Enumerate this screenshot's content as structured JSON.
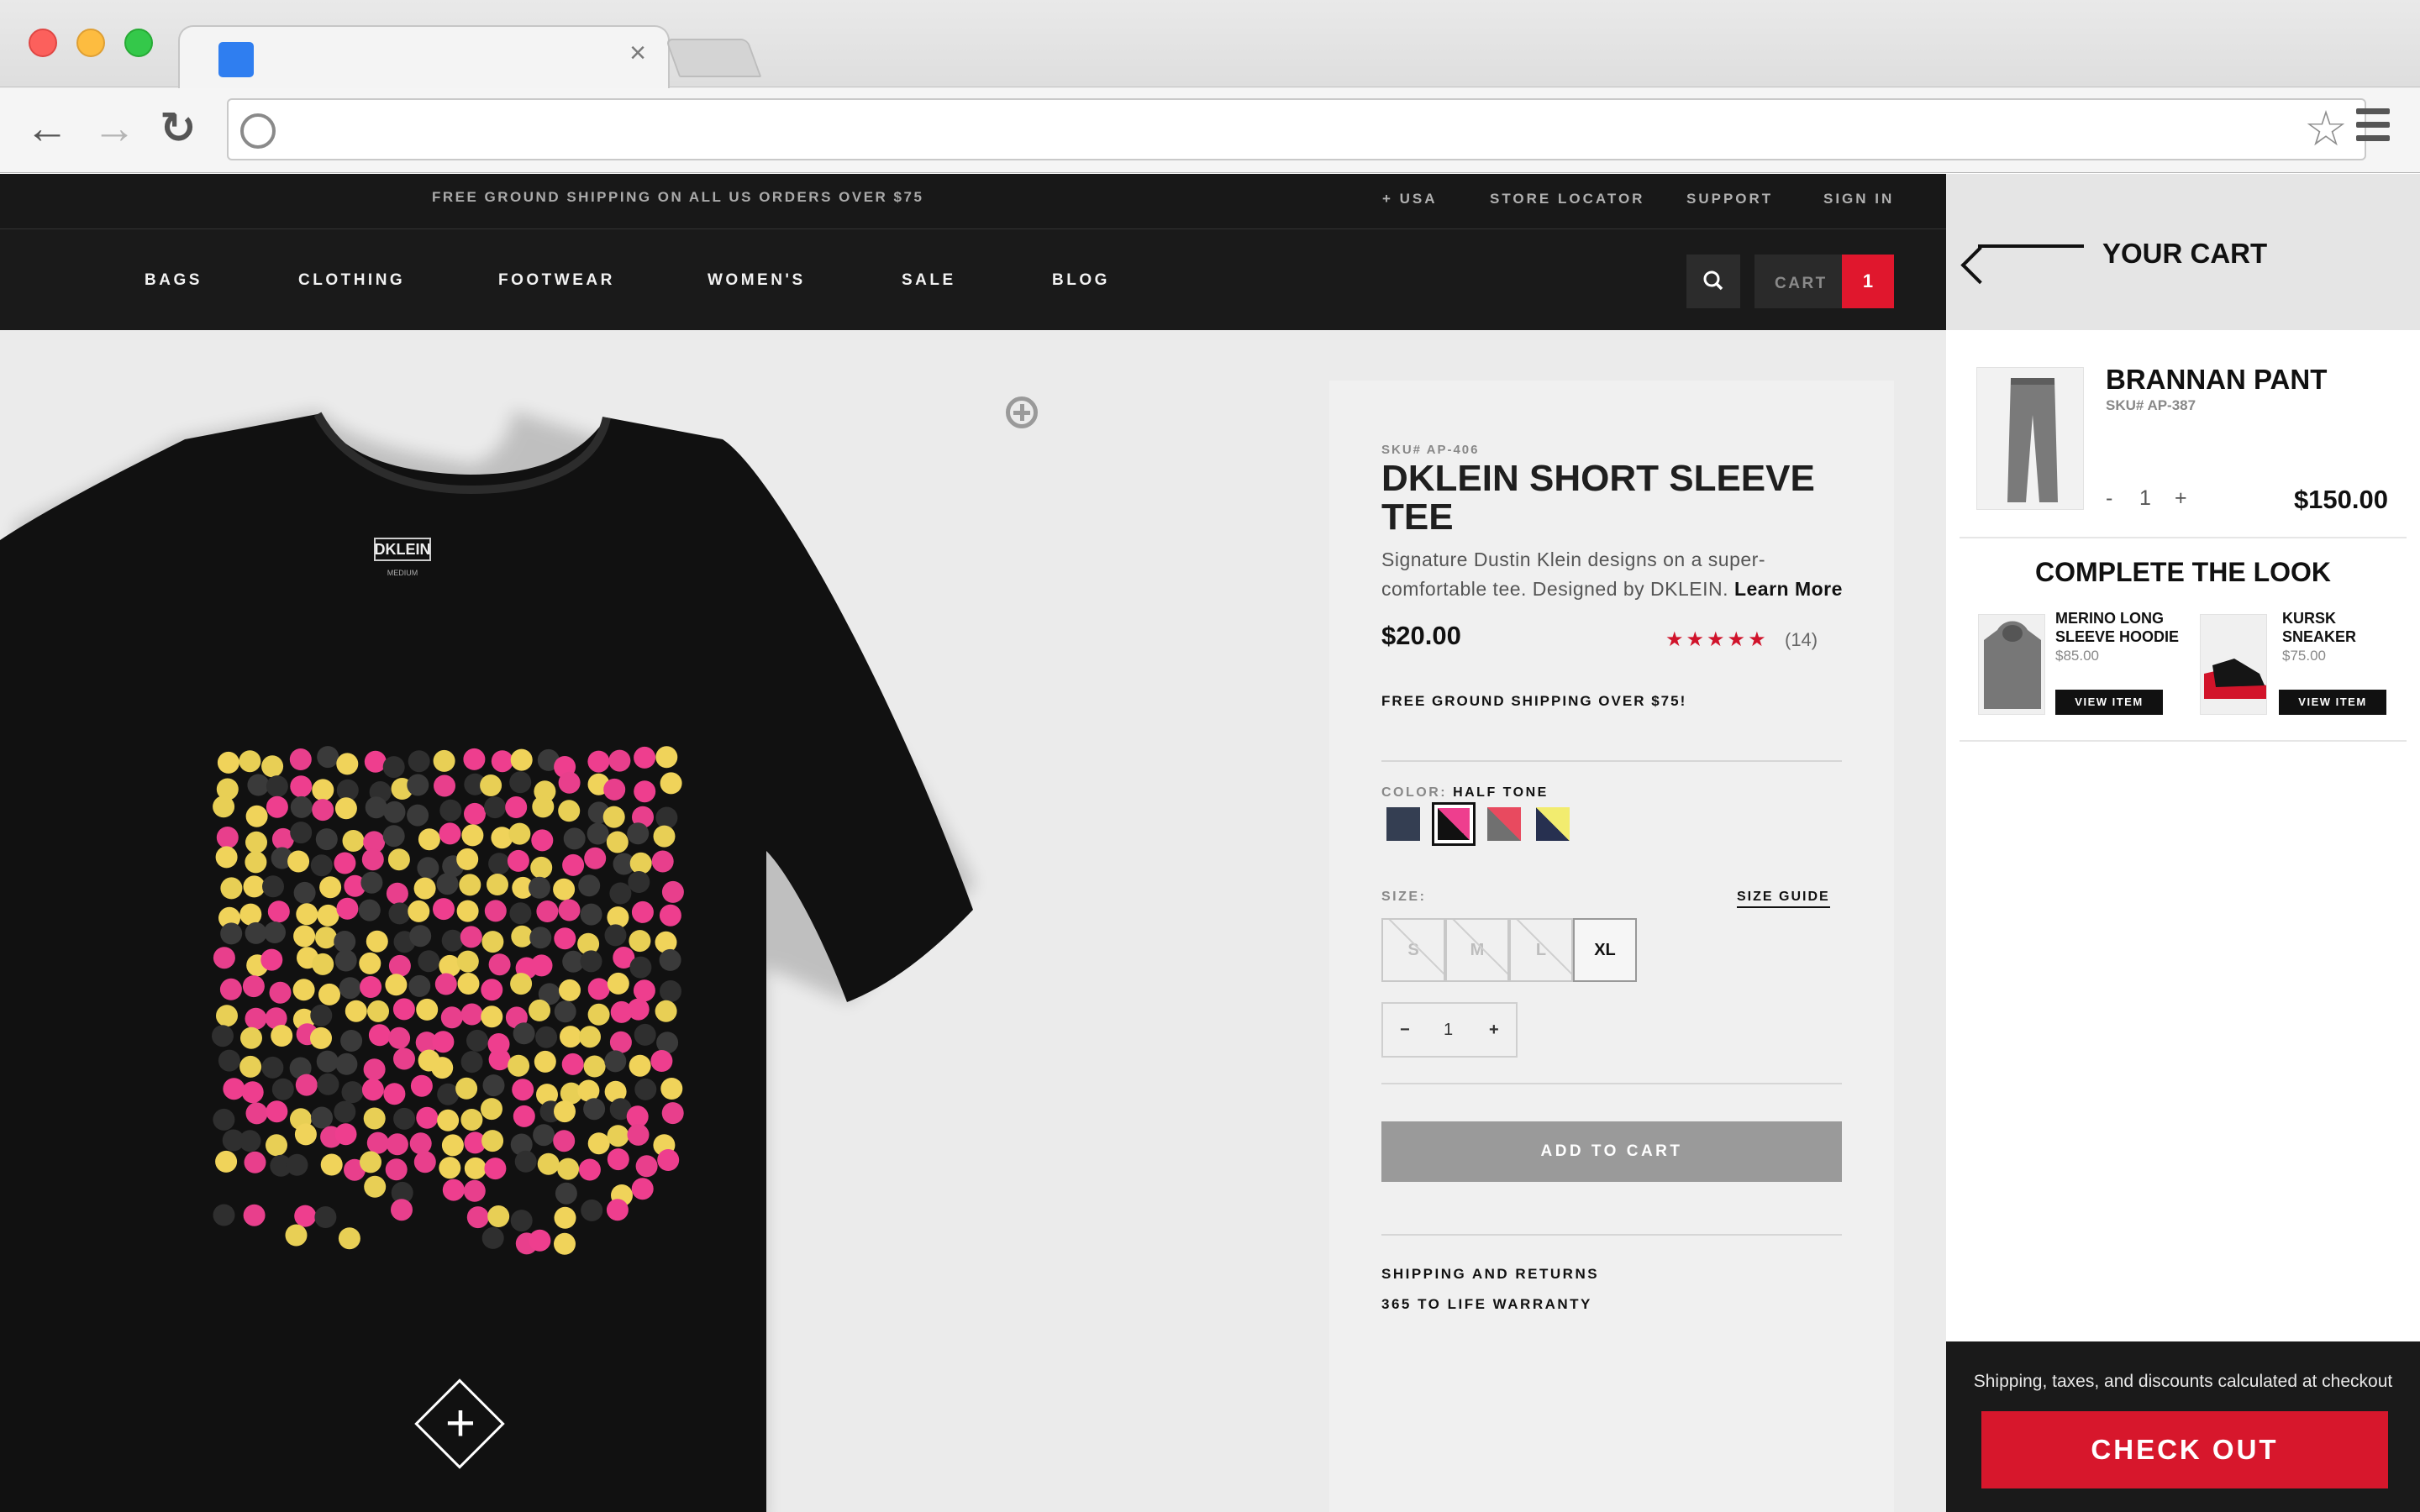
{
  "browser": {
    "tab_close_glyph": "×",
    "back_glyph": "←",
    "forward_glyph": "→",
    "reload_glyph": "↻",
    "star_glyph": "☆"
  },
  "site": {
    "promo": "FREE GROUND SHIPPING ON ALL US ORDERS OVER $75",
    "utility_links": [
      "+ USA",
      "STORE LOCATOR",
      "SUPPORT",
      "SIGN IN"
    ],
    "nav": [
      "BAGS",
      "CLOTHING",
      "FOOTWEAR",
      "WOMEN'S",
      "SALE",
      "BLOG"
    ],
    "search_icon": "search-icon",
    "cart_label": "CART",
    "cart_count": "1",
    "accent_color": "#e0172d"
  },
  "product": {
    "sku": "SKU# AP-406",
    "title": "DKLEIN SHORT SLEEVE TEE",
    "description": "Signature Dustin Klein designs on a super-comfortable tee. Designed by DKLEIN.",
    "learn_more": "Learn More",
    "price": "$20.00",
    "rating_stars": "★★★★★",
    "rating": 4.5,
    "reviews": "(14)",
    "free_shipping": "FREE GROUND SHIPPING OVER $75!",
    "color_label": "COLOR:",
    "color_value": "HALF TONE",
    "size_label": "SIZE:",
    "size_guide": "SIZE GUIDE",
    "sizes": [
      "S",
      "M",
      "L",
      "XL"
    ],
    "qty_minus": "−",
    "qty_value": "1",
    "qty_plus": "+",
    "add_to_cart": "ADD TO CART",
    "links": [
      "SHIPPING AND RETURNS",
      "365 TO LIFE WARRANTY"
    ],
    "tag_brand": "DKLEIN",
    "tag_size": "MEDIUM"
  },
  "cart": {
    "title": "YOUR CART",
    "item": {
      "name": "BRANNAN PANT",
      "sku": "SKU# AP-387",
      "qty_minus": "-",
      "qty": "1",
      "qty_plus": "+",
      "price": "$150.00"
    },
    "complete_the_look": "COMPLETE THE LOOK",
    "recommendations": [
      {
        "name": "MERINO LONG SLEEVE HOODIE",
        "price": "$85.00",
        "button": "VIEW ITEM"
      },
      {
        "name": "KURSK SNEAKER",
        "price": "$75.00",
        "button": "VIEW ITEM"
      }
    ],
    "footer_note": "Shipping, taxes, and discounts calculated at checkout",
    "checkout": "CHECK OUT"
  }
}
